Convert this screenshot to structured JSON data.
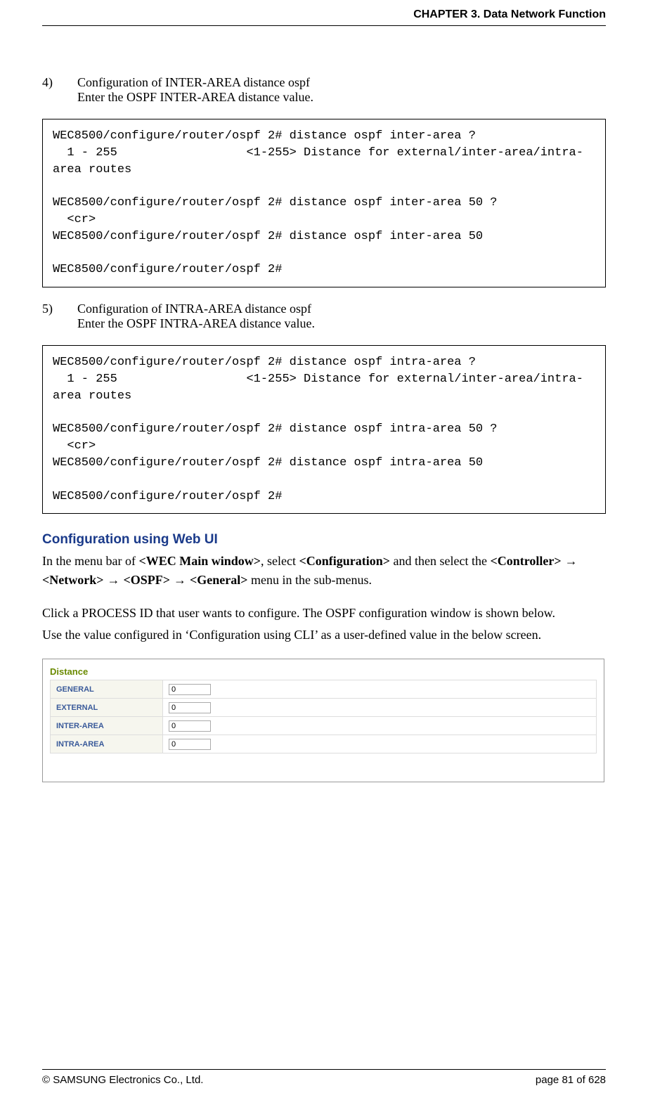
{
  "header": {
    "title": "CHAPTER 3. Data Network Function"
  },
  "item4": {
    "num": "4)",
    "title": "Configuration of INTER-AREA distance ospf",
    "desc": "Enter the OSPF INTER-AREA distance value."
  },
  "code4": "WEC8500/configure/router/ospf 2# distance ospf inter-area ?\n  1 - 255                  <1-255> Distance for external/inter-area/intra-area routes\n\nWEC8500/configure/router/ospf 2# distance ospf inter-area 50 ?\n  <cr>\nWEC8500/configure/router/ospf 2# distance ospf inter-area 50\n\nWEC8500/configure/router/ospf 2#",
  "item5": {
    "num": "5)",
    "title": "Configuration of INTRA-AREA distance ospf",
    "desc": "Enter the OSPF INTRA-AREA distance value."
  },
  "code5": "WEC8500/configure/router/ospf 2# distance ospf intra-area ?\n  1 - 255                  <1-255> Distance for external/inter-area/intra-area routes\n\nWEC8500/configure/router/ospf 2# distance ospf intra-area 50 ?\n  <cr>\nWEC8500/configure/router/ospf 2# distance ospf intra-area 50\n\nWEC8500/configure/router/ospf 2#",
  "webui": {
    "heading": "Configuration using Web UI",
    "p1a": "In the menu bar of ",
    "p1b": "<WEC Main window>",
    "p1c": ", select ",
    "p1d": "<Configuration>",
    "p1e": " and then select the ",
    "p2a": "<Controller>",
    "arrow": " → ",
    "p2b": "<Network>",
    "p2c": "<OSPF>",
    "p2d": "<General>",
    "p2e": " menu in the sub-menus.",
    "p3": "Click a PROCESS ID that user wants to configure. The OSPF configuration window is shown below.",
    "p4": "Use the value configured in ‘Configuration using CLI’ as a user-defined value in the below screen."
  },
  "distance": {
    "title": "Distance",
    "rows": [
      {
        "label": "GENERAL",
        "value": "0"
      },
      {
        "label": "EXTERNAL",
        "value": "0"
      },
      {
        "label": "INTER-AREA",
        "value": "0"
      },
      {
        "label": "INTRA-AREA",
        "value": "0"
      }
    ]
  },
  "footer": {
    "left": "© SAMSUNG Electronics Co., Ltd.",
    "right": "page 81 of 628"
  }
}
